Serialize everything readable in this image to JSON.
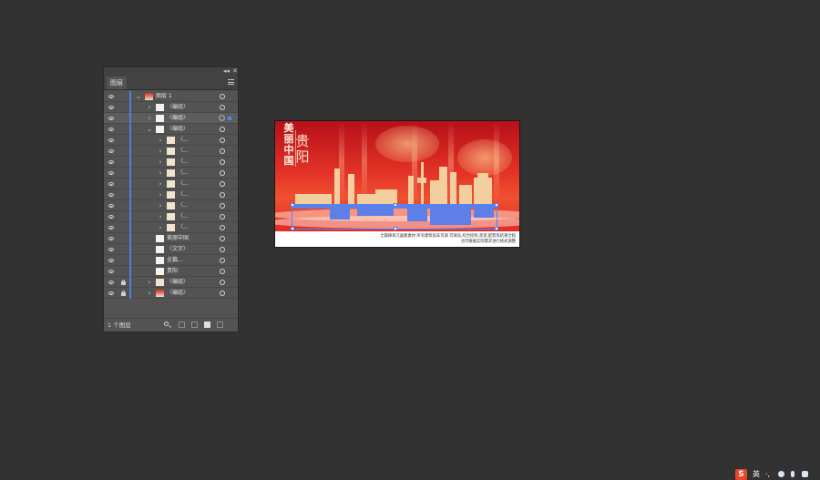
{
  "layers_panel": {
    "tab_label": "图层",
    "collapse_glyph": "◂◂",
    "close_glyph": "✕",
    "footer_label": "1 个图层",
    "rows": [
      {
        "label": "图层 1",
        "indent": 0,
        "chevron": "⌄",
        "thumb": "dark",
        "locked": false,
        "selected": false,
        "target": "plain",
        "sel_square": false
      },
      {
        "label": "〈编组〉",
        "indent": 1,
        "chevron": "›",
        "thumb": "light",
        "locked": false,
        "selected": false,
        "target": "plain",
        "sel_square": false
      },
      {
        "label": "〈编组〉",
        "indent": 1,
        "chevron": "›",
        "thumb": "light",
        "locked": false,
        "selected": true,
        "target": "active",
        "sel_square": true
      },
      {
        "label": "〈编组〉",
        "indent": 1,
        "chevron": "⌄",
        "thumb": "light",
        "locked": false,
        "selected": false,
        "target": "plain",
        "sel_square": false
      },
      {
        "label": "〈...",
        "indent": 2,
        "chevron": "›",
        "thumb": "warm",
        "locked": false,
        "selected": false,
        "target": "plain",
        "sel_square": false
      },
      {
        "label": "〈...",
        "indent": 2,
        "chevron": "›",
        "thumb": "warm",
        "locked": false,
        "selected": false,
        "target": "plain",
        "sel_square": false
      },
      {
        "label": "〈...",
        "indent": 2,
        "chevron": "›",
        "thumb": "warm",
        "locked": false,
        "selected": false,
        "target": "plain",
        "sel_square": false
      },
      {
        "label": "〈...",
        "indent": 2,
        "chevron": "›",
        "thumb": "warm",
        "locked": false,
        "selected": false,
        "target": "plain",
        "sel_square": false
      },
      {
        "label": "〈...",
        "indent": 2,
        "chevron": "›",
        "thumb": "warm",
        "locked": false,
        "selected": false,
        "target": "plain",
        "sel_square": false
      },
      {
        "label": "〈...",
        "indent": 2,
        "chevron": "›",
        "thumb": "warm",
        "locked": false,
        "selected": false,
        "target": "plain",
        "sel_square": false
      },
      {
        "label": "〈...",
        "indent": 2,
        "chevron": "›",
        "thumb": "warm",
        "locked": false,
        "selected": false,
        "target": "plain",
        "sel_square": false
      },
      {
        "label": "〈...",
        "indent": 2,
        "chevron": "›",
        "thumb": "warm",
        "locked": false,
        "selected": false,
        "target": "plain",
        "sel_square": false
      },
      {
        "label": "〈...",
        "indent": 2,
        "chevron": "›",
        "thumb": "warm",
        "locked": false,
        "selected": false,
        "target": "plain",
        "sel_square": false
      },
      {
        "label": "美丽中国",
        "indent": 1,
        "chevron": "",
        "thumb": "light",
        "locked": false,
        "selected": false,
        "target": "plain",
        "sel_square": false
      },
      {
        "label": "〈文字〉",
        "indent": 1,
        "chevron": "",
        "thumb": "light",
        "locked": false,
        "selected": false,
        "target": "plain",
        "sel_square": false
      },
      {
        "label": "全篇...",
        "indent": 1,
        "chevron": "",
        "thumb": "light",
        "locked": false,
        "selected": false,
        "target": "plain",
        "sel_square": false
      },
      {
        "label": "贵阳",
        "indent": 1,
        "chevron": "",
        "thumb": "light",
        "locked": false,
        "selected": false,
        "target": "plain",
        "sel_square": false
      },
      {
        "label": "〈编组〉",
        "indent": 1,
        "chevron": "›",
        "thumb": "warm",
        "locked": true,
        "selected": false,
        "target": "plain",
        "sel_square": false
      },
      {
        "label": "〈编组〉",
        "indent": 1,
        "chevron": "›",
        "thumb": "dark",
        "locked": true,
        "selected": false,
        "target": "plain",
        "sel_square": false
      }
    ]
  },
  "artboard": {
    "vertical_title": "美丽中国",
    "city_name": "贵阳",
    "caption_line1": "全篇樟系元器素素材 所有建筑除非可调 可填充,综合结构,装受,配影等结果全程",
    "caption_line2": "也可根据实际需求进行格式调整"
  },
  "tray": {
    "ime_logo": "S",
    "ime_mode": "英",
    "punct": "·,"
  },
  "colors": {
    "selection_blue": "#4f86f7",
    "poster_red": "#e23126",
    "skyline_gold": "#f3cfa0",
    "water_blue": "#5f7fe8"
  }
}
